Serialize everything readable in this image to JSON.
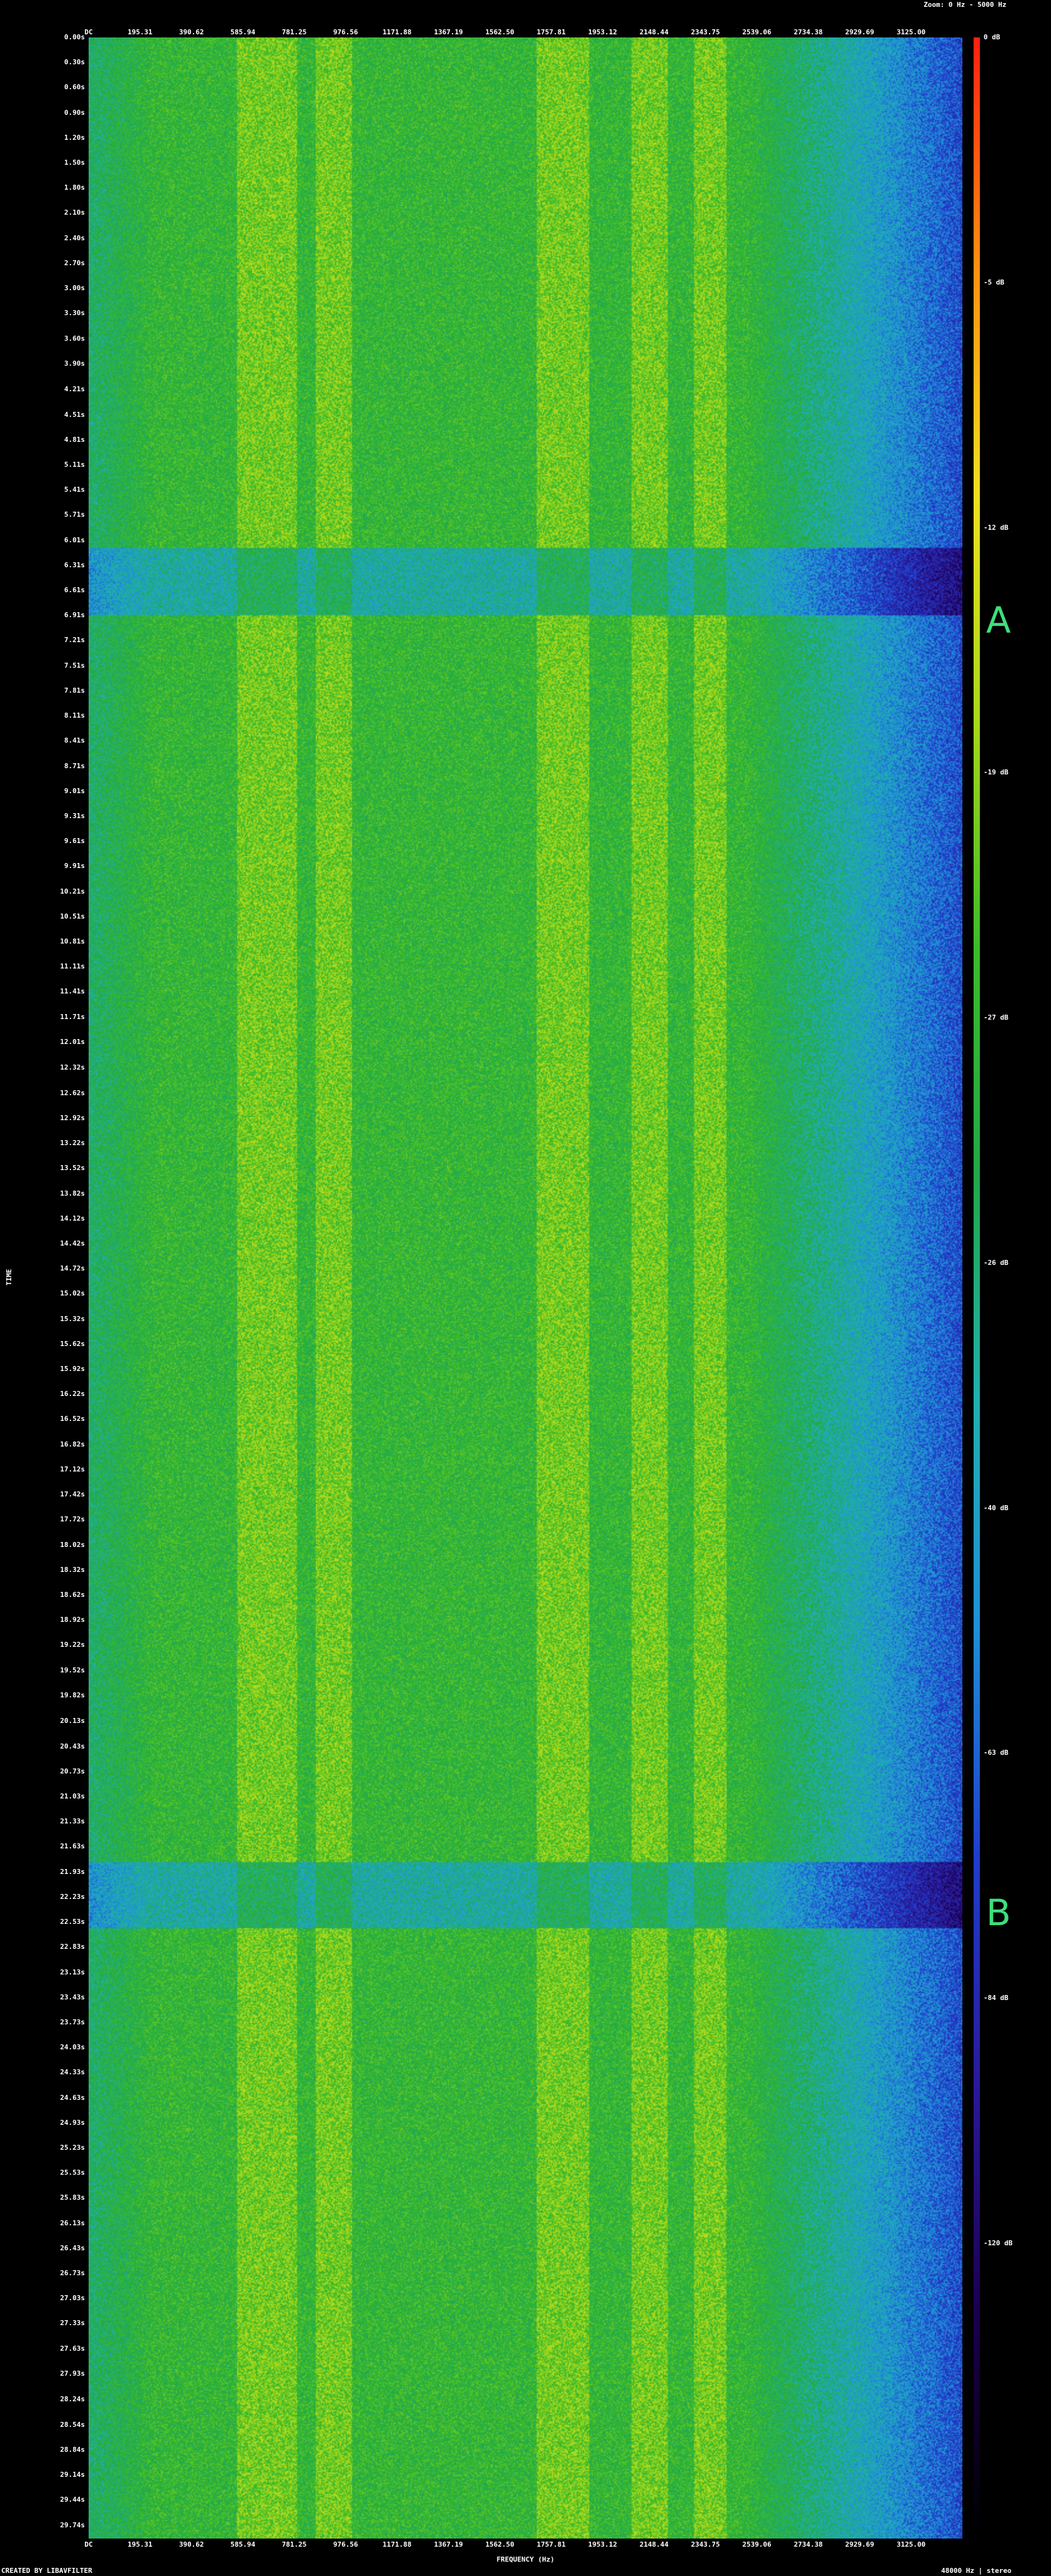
{
  "chart_data": {
    "type": "heatmap",
    "zoom_label": "Zoom: 0 Hz - 5000 Hz",
    "footer_left": "CREATED BY LIBAVFILTER",
    "footer_right": "48000 Hz | stereo",
    "xlabel": "FREQUENCY (Hz)",
    "ylabel": "TIME",
    "freq_ticks": [
      "DC",
      "195.31",
      "390.62",
      "585.94",
      "781.25",
      "976.56",
      "1171.88",
      "1367.19",
      "1562.50",
      "1757.81",
      "1953.12",
      "2148.44",
      "2343.75",
      "2539.06",
      "2734.38",
      "2929.69",
      "3125.00"
    ],
    "xlim": [
      0,
      3320
    ],
    "time_ticks": [
      "0.00s",
      "0.30s",
      "0.60s",
      "0.90s",
      "1.20s",
      "1.50s",
      "1.80s",
      "2.10s",
      "2.40s",
      "2.70s",
      "3.00s",
      "3.30s",
      "3.60s",
      "3.90s",
      "4.21s",
      "4.51s",
      "4.81s",
      "5.11s",
      "5.41s",
      "5.71s",
      "6.01s",
      "6.31s",
      "6.61s",
      "6.91s",
      "7.21s",
      "7.51s",
      "7.81s",
      "8.11s",
      "8.41s",
      "8.71s",
      "9.01s",
      "9.31s",
      "9.61s",
      "9.91s",
      "10.21s",
      "10.51s",
      "10.81s",
      "11.11s",
      "11.41s",
      "11.71s",
      "12.01s",
      "12.32s",
      "12.62s",
      "12.92s",
      "13.22s",
      "13.52s",
      "13.82s",
      "14.12s",
      "14.42s",
      "14.72s",
      "15.02s",
      "15.32s",
      "15.62s",
      "15.92s",
      "16.22s",
      "16.52s",
      "16.82s",
      "17.12s",
      "17.42s",
      "17.72s",
      "18.02s",
      "18.32s",
      "18.62s",
      "18.92s",
      "19.22s",
      "19.52s",
      "19.82s",
      "20.13s",
      "20.43s",
      "20.73s",
      "21.03s",
      "21.33s",
      "21.63s",
      "21.93s",
      "22.23s",
      "22.53s",
      "22.83s",
      "23.13s",
      "23.43s",
      "23.73s",
      "24.03s",
      "24.33s",
      "24.63s",
      "24.93s",
      "25.23s",
      "25.53s",
      "25.83s",
      "26.13s",
      "26.43s",
      "26.73s",
      "27.03s",
      "27.33s",
      "27.63s",
      "27.93s",
      "28.24s",
      "28.54s",
      "28.84s",
      "29.14s",
      "29.44s",
      "29.74s"
    ],
    "ylim": [
      0,
      29.9
    ],
    "db_ticks": [
      "0 dB",
      "-5 dB",
      "-12 dB",
      "-19 dB",
      "-27 dB",
      "-26 dB",
      "-40 dB",
      "-63 dB",
      "-84 dB",
      "-120 dB"
    ],
    "db_tick_fractions": [
      0,
      0.098,
      0.196,
      0.294,
      0.392,
      0.49,
      0.588,
      0.686,
      0.784,
      0.882
    ],
    "colormap": [
      "#000000",
      "#1a0050",
      "#2a1a9a",
      "#1f3fcc",
      "#1f8fd8",
      "#20b0b0",
      "#22a848",
      "#3cbc2a",
      "#a8d81a",
      "#f0e020",
      "#ff9010",
      "#ff2010"
    ],
    "bright_bands_hz": [
      [
        560,
        790
      ],
      [
        860,
        1000
      ],
      [
        1700,
        1900
      ],
      [
        2060,
        2200
      ],
      [
        2300,
        2420
      ]
    ],
    "dips_s": [
      [
        6.1,
        6.9
      ],
      [
        21.8,
        22.6
      ]
    ],
    "markers": [
      {
        "label": "A",
        "time_s": 7.0
      },
      {
        "label": "B",
        "time_s": 22.45
      }
    ],
    "grid": false
  }
}
